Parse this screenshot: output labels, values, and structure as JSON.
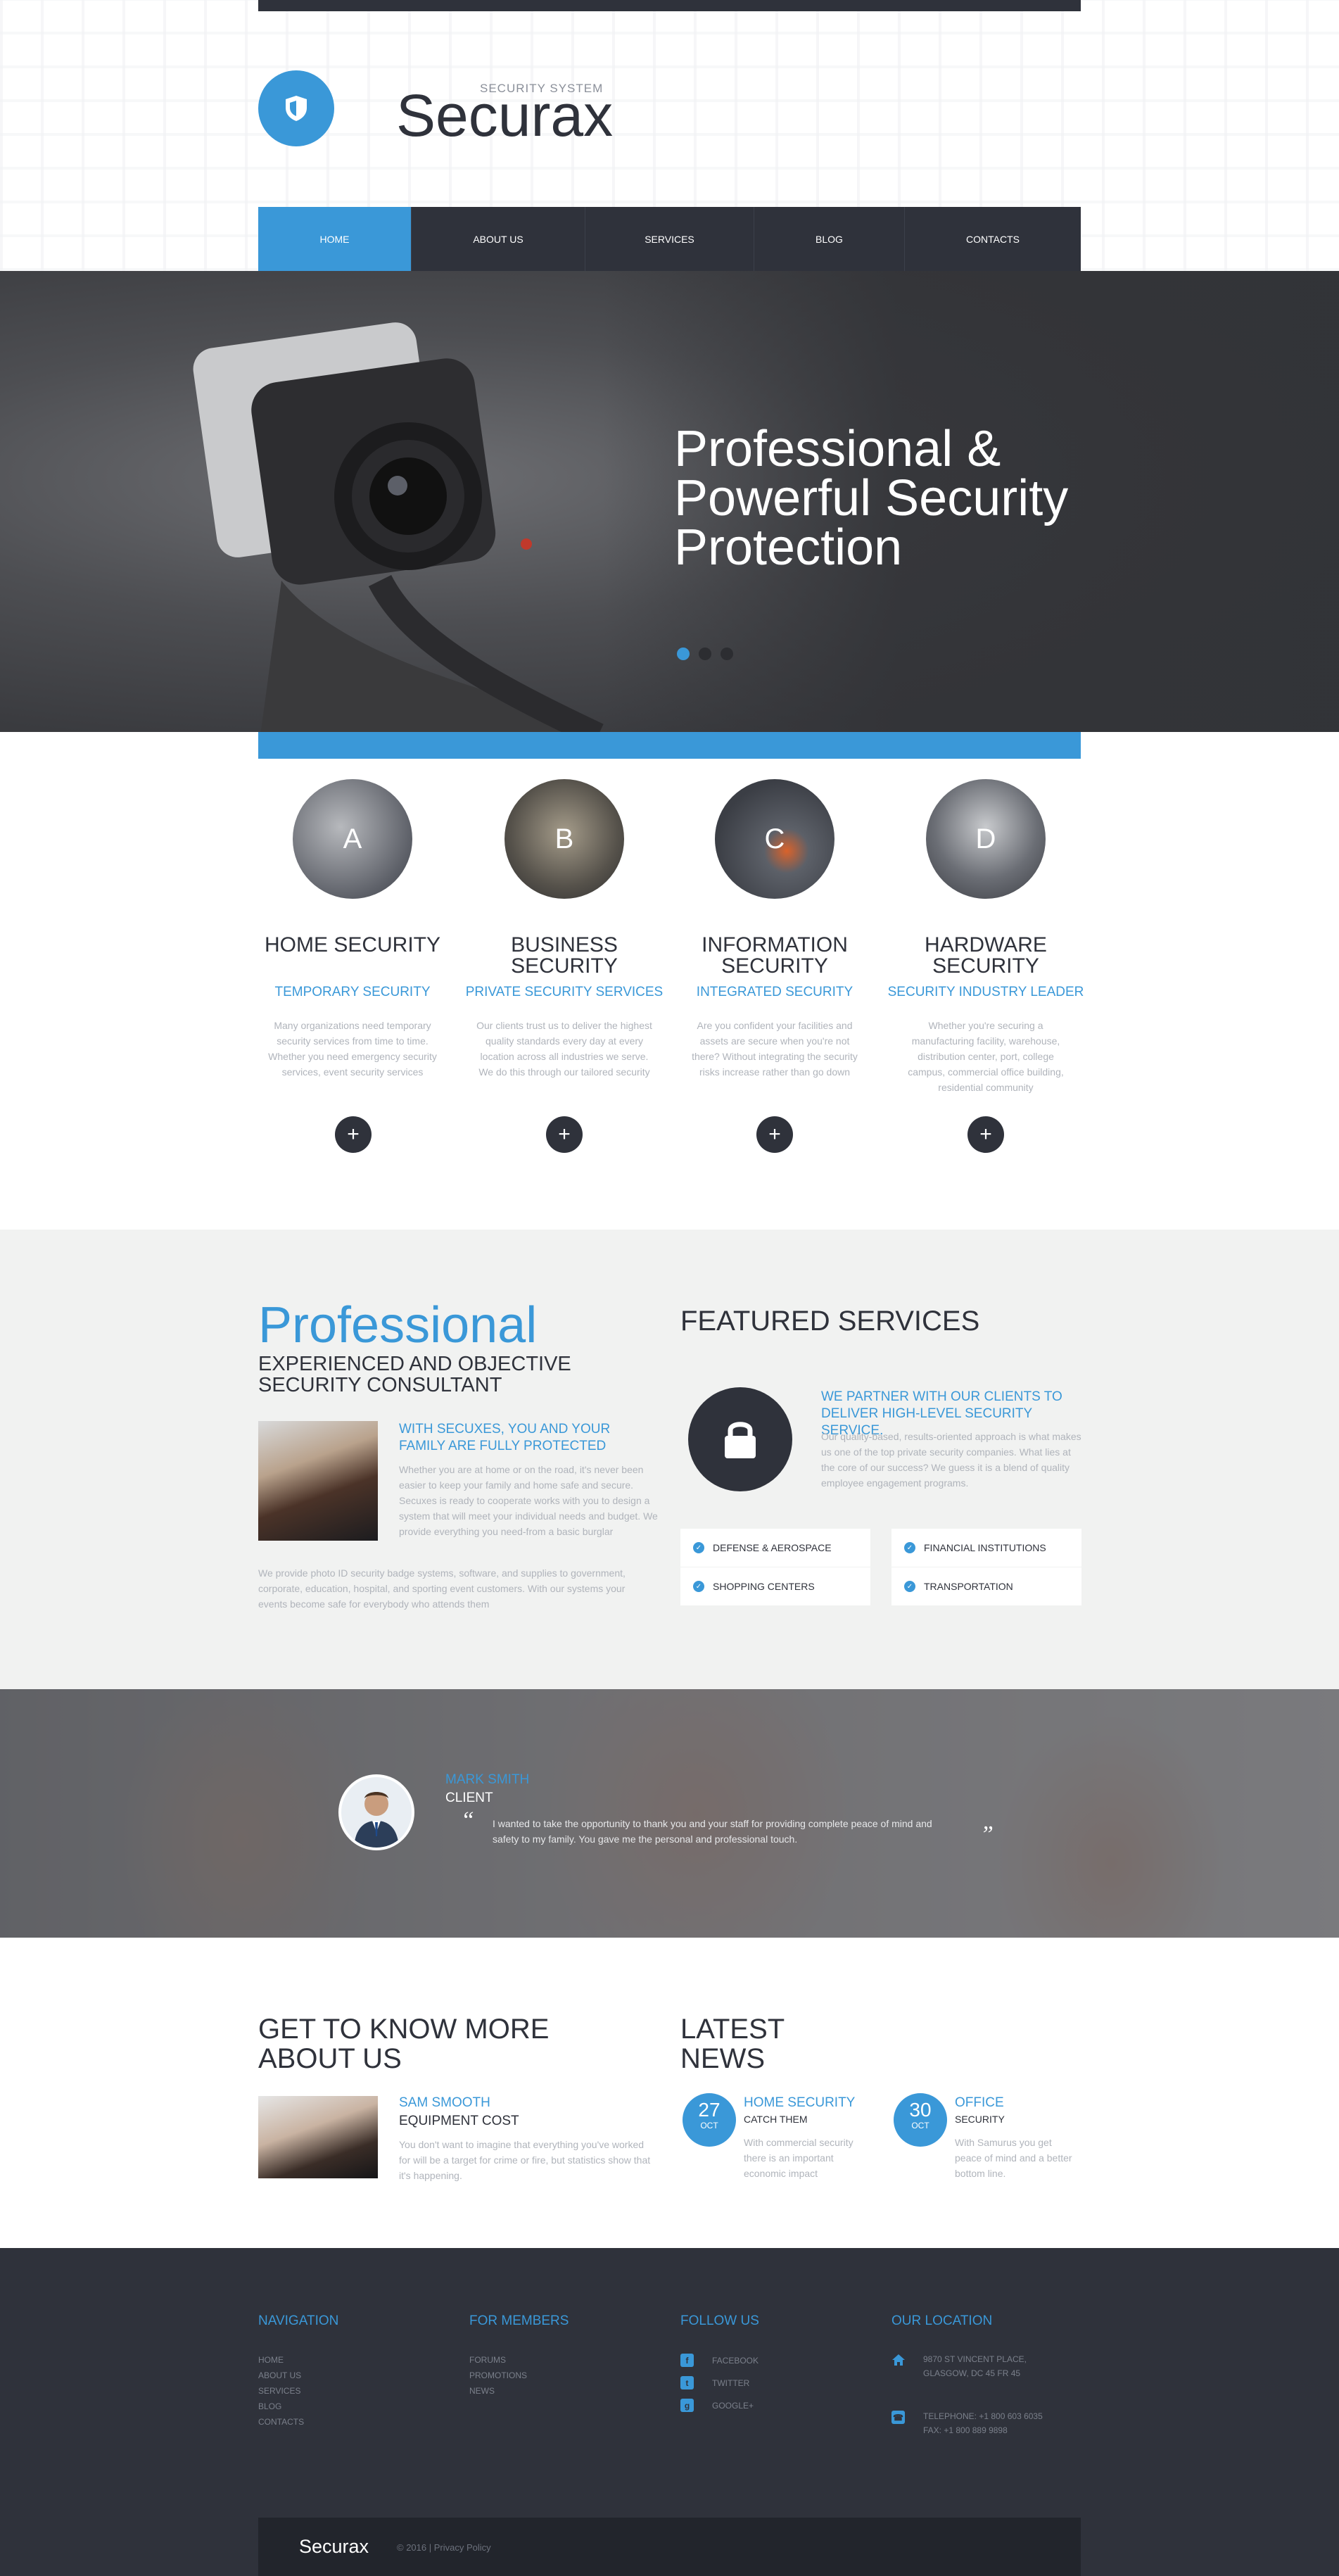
{
  "colors": {
    "accent": "#3a98d8",
    "dark": "#2f323b",
    "muted_text": "#b0b4bb"
  },
  "header": {
    "tagline": "SECURITY SYSTEM",
    "brand": "Securax",
    "logo_icon": "shield-icon"
  },
  "nav": {
    "items": [
      {
        "label": "HOME",
        "active": true
      },
      {
        "label": "ABOUT US",
        "active": false
      },
      {
        "label": "SERVICES",
        "active": false
      },
      {
        "label": "BLOG",
        "active": false
      },
      {
        "label": "CONTACTS",
        "active": false
      }
    ]
  },
  "hero": {
    "title": "Professional & Powerful Security Protection",
    "slides": 3,
    "active_slide": 1
  },
  "features": [
    {
      "letter": "A",
      "title": "HOME SECURITY",
      "subtitle": "TEMPORARY SECURITY",
      "text": "Many organizations need temporary security services from time to time. Whether you need emergency security services, event security services"
    },
    {
      "letter": "B",
      "title": "BUSINESS SECURITY",
      "subtitle": "PRIVATE SECURITY SERVICES",
      "text": "Our clients trust us to deliver the highest quality standards every day at every location across all industries we serve. We do this through our tailored security"
    },
    {
      "letter": "C",
      "title": "INFORMATION SECURITY",
      "subtitle": "INTEGRATED SECURITY",
      "text": "Are you confident your facilities and assets are secure when you're not there? Without integrating the security risks increase rather than go down"
    },
    {
      "letter": "D",
      "title": "HARDWARE SECURITY",
      "subtitle": "SECURITY INDUSTRY LEADER",
      "text": "Whether you're securing a manufacturing facility, warehouse, distribution center, port, college campus, commercial office building, residential community"
    }
  ],
  "professional": {
    "title": "Professional",
    "subtitle": "EXPERIENCED AND OBJECTIVE SECURITY CONSULTANT",
    "side_title": "WITH SECUXES, YOU AND YOUR FAMILY ARE FULLY PROTECTED",
    "side_text": "Whether you are at home or on the road, it's never been easier to keep your family and home safe and secure. Secuxes is ready to cooperate works with you to design a system that will meet your individual needs and budget. We provide everything you need-from a basic burglar",
    "bottom_text": "We provide photo ID security badge systems, software, and supplies to government, corporate, education, hospital, and sporting event customers. With our systems your events become safe for everybody who attends them"
  },
  "featured_services": {
    "title": "FEATURED SERVICES",
    "icon": "lock-icon",
    "headline": "WE PARTNER WITH OUR CLIENTS TO DELIVER HIGH-LEVEL SECURITY SERVICE.",
    "text": "Our quality-based, results-oriented approach is what makes us one of the top private security companies. What lies at the core of our success? We guess it is a blend of quality employee engagement programs.",
    "items": [
      "DEFENSE & AEROSPACE",
      "FINANCIAL INSTITUTIONS",
      "SHOPPING CENTERS",
      "TRANSPORTATION"
    ]
  },
  "testimonial": {
    "name": "MARK SMITH",
    "role": "CLIENT",
    "quote_open": "“",
    "quote_close": "”",
    "text": "I wanted to take the opportunity to thank you and your staff for providing complete peace of mind and safety to my family. You gave me the personal and professional touch."
  },
  "about": {
    "title": "GET TO KNOW MORE ABOUT US",
    "name": "SAM SMOOTH",
    "role": "EQUIPMENT COST",
    "text": "You don't want to imagine that everything you've worked for will be a target for crime or fire, but statistics show that it's happening."
  },
  "news": {
    "title": "LATEST NEWS",
    "items": [
      {
        "day": "27",
        "month": "OCT",
        "title": "HOME SECURITY",
        "sub": "CATCH THEM",
        "text": "With commercial security there is an important economic impact"
      },
      {
        "day": "30",
        "month": "OCT",
        "title": "OFFICE",
        "sub": "SECURITY",
        "text": "With Samurus you get peace of mind and a better bottom line."
      }
    ]
  },
  "footer": {
    "navigation": {
      "title": "NAVIGATION",
      "links": [
        "HOME",
        "ABOUT US",
        "SERVICES",
        "BLOG",
        "CONTACTS"
      ]
    },
    "members": {
      "title": "FOR MEMBERS",
      "links": [
        "FORUMS",
        "PROMOTIONS",
        "NEWS"
      ]
    },
    "follow": {
      "title": "FOLLOW US",
      "links": [
        {
          "label": "FACEBOOK",
          "icon": "facebook-icon"
        },
        {
          "label": "TWITTER",
          "icon": "twitter-icon"
        },
        {
          "label": "GOOGLE+",
          "icon": "google-plus-icon"
        }
      ]
    },
    "location": {
      "title": "OUR LOCATION",
      "address_line1": "9870 ST VINCENT PLACE,",
      "address_line2": "GLASGOW, DC 45 FR 45",
      "phone": "TELEPHONE: +1 800 603 6035",
      "fax": "FAX: +1 800 889 9898",
      "address_icon": "home-icon",
      "phone_icon": "phone-icon"
    },
    "brand": "Securax",
    "copyright": "© 2016 | Privacy Policy"
  }
}
